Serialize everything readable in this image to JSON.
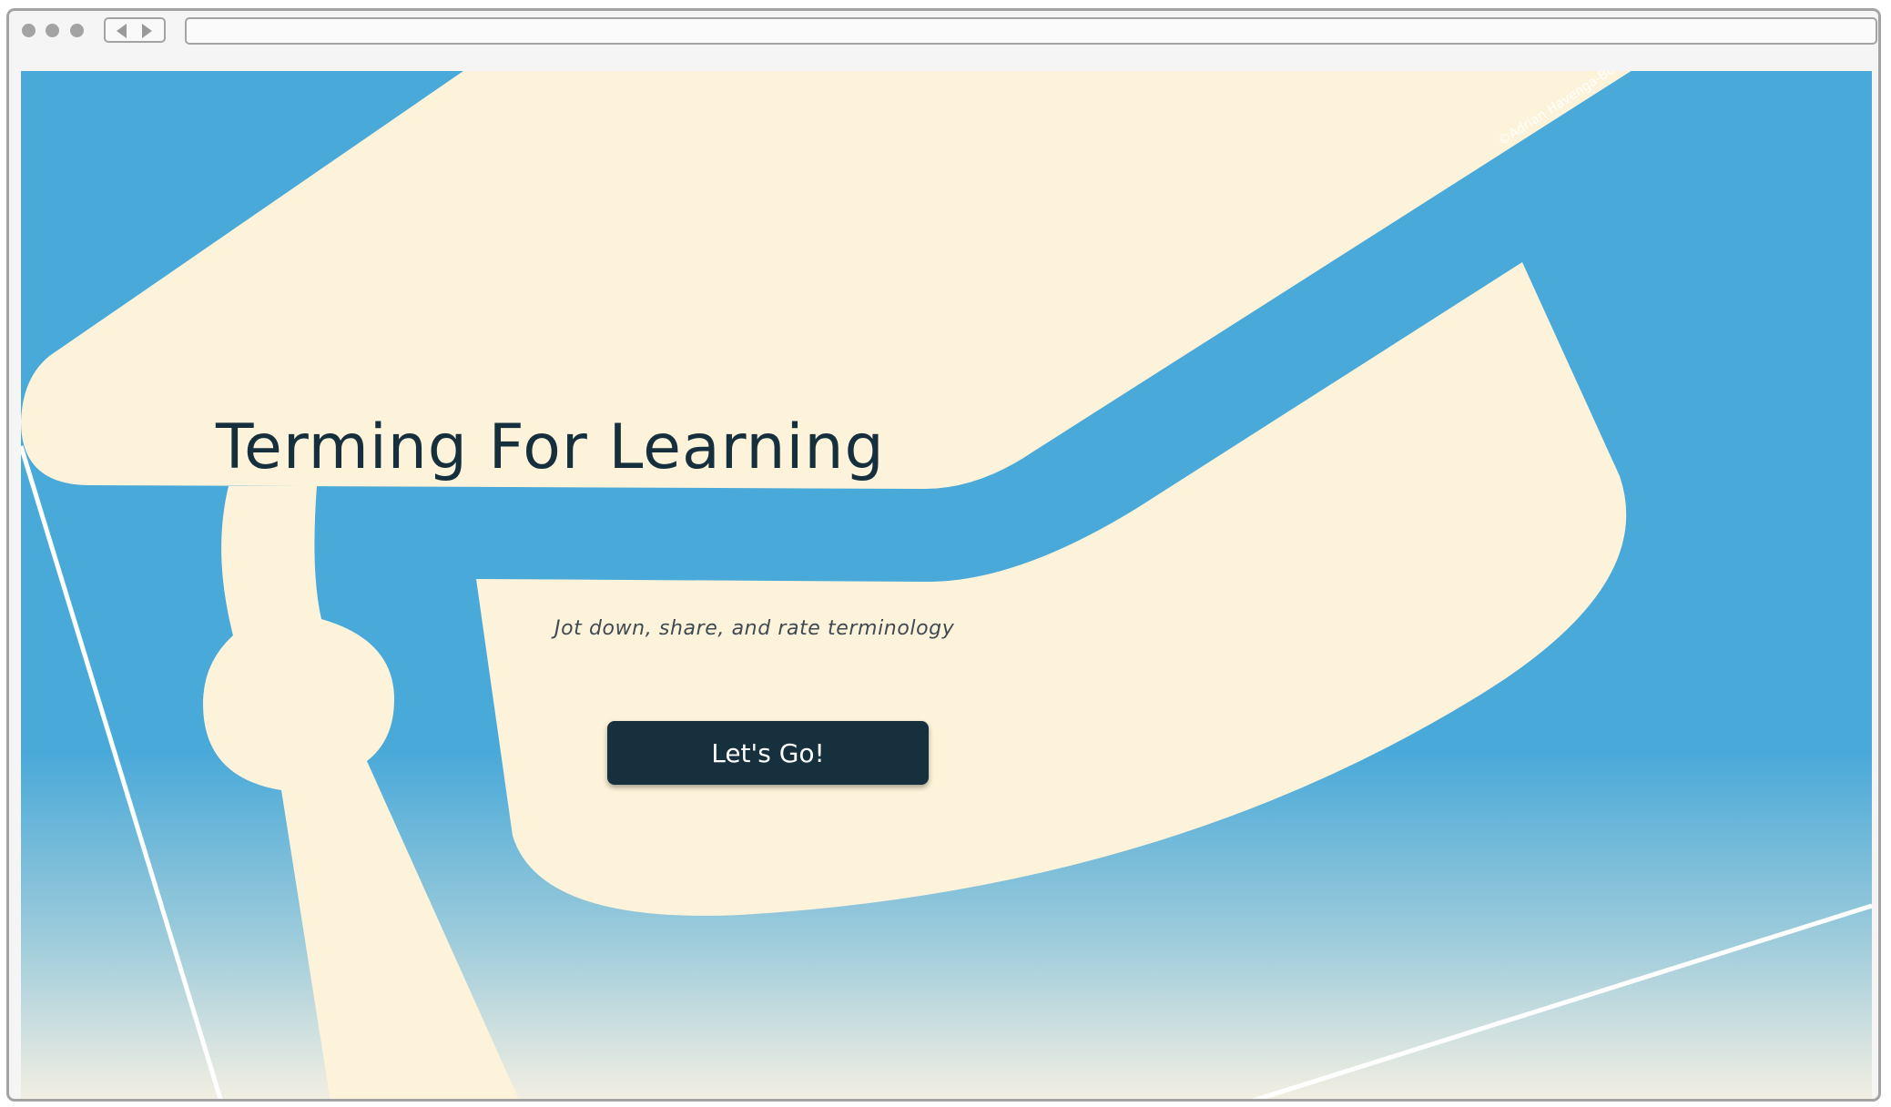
{
  "browser": {
    "address": ""
  },
  "hero": {
    "title": "Terming For Learning",
    "subtitle": "Jot down, share, and rate terminology",
    "cta_label": "Let's Go!",
    "copyright": "©Adrian Havenga-Bennett"
  },
  "colors": {
    "sky_blue": "#49a9d9",
    "cream": "#fdf3da",
    "navy": "#16303d",
    "frame_gray": "#a3a3a3"
  },
  "icons": {
    "back": "triangle-left-icon",
    "forward": "triangle-right-icon",
    "art": "graduation-cap-illustration"
  }
}
